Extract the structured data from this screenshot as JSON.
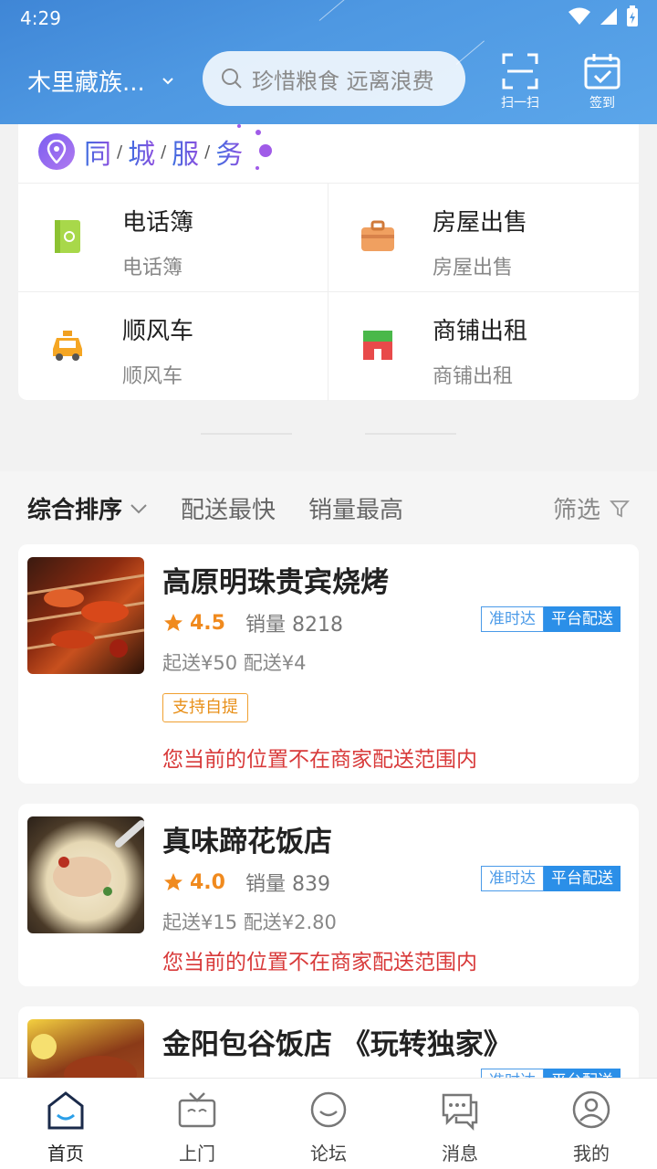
{
  "status": {
    "time": "4:29"
  },
  "header": {
    "location": "木里藏族...",
    "search_placeholder": "珍惜粮食 远离浪费",
    "scan_label": "扫一扫",
    "signin_label": "签到"
  },
  "service": {
    "title_chars": [
      "同",
      "城",
      "服",
      "务"
    ],
    "separator": "/",
    "items": [
      {
        "title": "电话簿",
        "subtitle": "电话簿",
        "icon": "phonebook-icon"
      },
      {
        "title": "房屋出售",
        "subtitle": "房屋出售",
        "icon": "briefcase-icon"
      },
      {
        "title": "顺风车",
        "subtitle": "顺风车",
        "icon": "taxi-icon"
      },
      {
        "title": "商铺出租",
        "subtitle": "商铺出租",
        "icon": "storefront-icon"
      }
    ]
  },
  "sort": {
    "active": "综合排序",
    "options": [
      "配送最快",
      "销量最高"
    ],
    "filter": "筛选"
  },
  "shops": [
    {
      "name": "高原明珠贵宾烧烤",
      "rating": "4.5",
      "sales": "销量 8218",
      "badge_a": "准时达",
      "badge_b": "平台配送",
      "fees": "起送¥50  配送¥4",
      "pickup": "支持自提",
      "warning": "您当前的位置不在商家配送范围内"
    },
    {
      "name": "真味蹄花饭店",
      "rating": "4.0",
      "sales": "销量 839",
      "badge_a": "准时达",
      "badge_b": "平台配送",
      "fees": "起送¥15  配送¥2.80",
      "warning": "您当前的位置不在商家配送范围内"
    },
    {
      "name": "金阳包谷饭店  《玩转独家》",
      "badge_a": "准时达",
      "badge_b": "平台配送"
    }
  ],
  "nav": [
    {
      "label": "首页",
      "icon": "home-icon"
    },
    {
      "label": "上门",
      "icon": "tv-icon"
    },
    {
      "label": "论坛",
      "icon": "forum-icon"
    },
    {
      "label": "消息",
      "icon": "message-icon"
    },
    {
      "label": "我的",
      "icon": "profile-icon"
    }
  ],
  "colors": {
    "header": "#4e98e2",
    "accent_orange": "#f08a1e",
    "warning_red": "#d83a3a",
    "badge_blue": "#2b8fe8"
  }
}
